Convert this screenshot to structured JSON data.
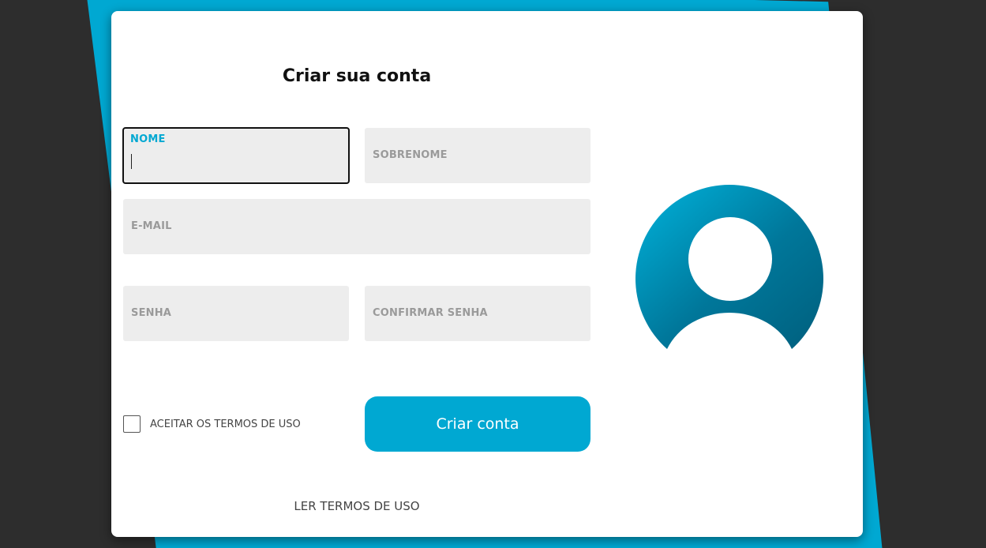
{
  "form": {
    "title": "Criar sua conta",
    "fields": {
      "nome": {
        "label": "NOME",
        "value": ""
      },
      "sobrenome": {
        "label": "SOBRENOME",
        "value": ""
      },
      "email": {
        "label": "E-MAIL",
        "value": ""
      },
      "senha": {
        "label": "SENHA",
        "value": ""
      },
      "confirmar_senha": {
        "label": "CONFIRMAR SENHA",
        "value": ""
      }
    },
    "terms_checkbox_label": "ACEITAR OS TERMOS DE USO",
    "terms_checked": false,
    "submit_label": "Criar conta",
    "read_terms_link": "LER TERMOS DE USO"
  },
  "icons": {
    "avatar": "user-avatar-icon"
  },
  "colors": {
    "accent": "#00a8d2",
    "accent_dark": "#00779a",
    "background": "#2d2d2d",
    "field_bg": "#ededed",
    "label": "#9a9a9a"
  }
}
